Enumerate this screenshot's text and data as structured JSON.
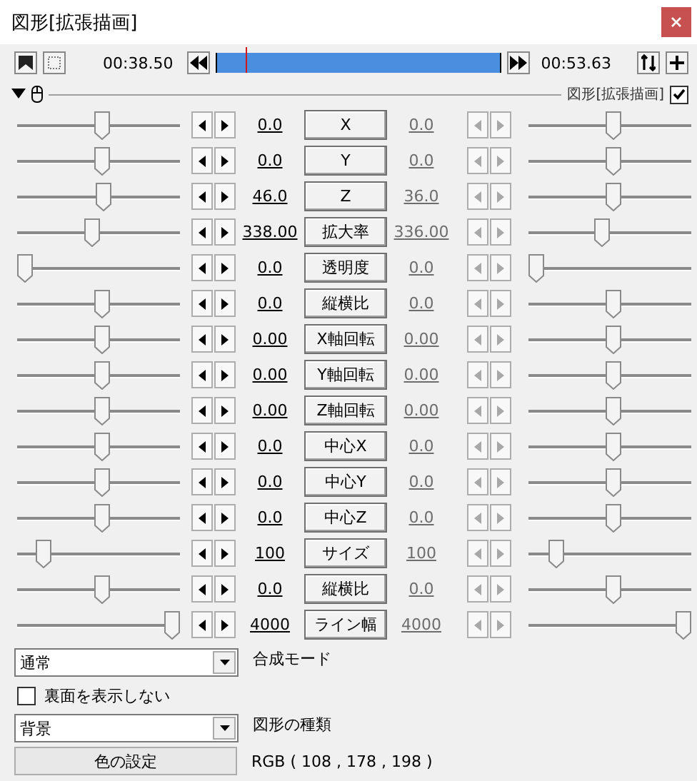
{
  "window": {
    "title": "図形[拡張描画]"
  },
  "toolbar": {
    "start_time": "00:38.50",
    "end_time": "00:53.63",
    "playhead": {
      "level": 0.1
    }
  },
  "object": {
    "label": "図形[拡張描画]",
    "checked": true,
    "expanded": true
  },
  "tracks": [
    {
      "name": "X",
      "start": {
        "value": "0.0",
        "level": 0.52
      },
      "end": {
        "value": "0.0",
        "level": 0.52,
        "disabled": true
      }
    },
    {
      "name": "Y",
      "start": {
        "value": "0.0",
        "level": 0.52
      },
      "end": {
        "value": "0.0",
        "level": 0.52,
        "disabled": true
      }
    },
    {
      "name": "Z",
      "start": {
        "value": "46.0",
        "level": 0.53
      },
      "end": {
        "value": "36.0",
        "level": 0.52,
        "disabled": true
      }
    },
    {
      "name": "拡大率",
      "start": {
        "value": "338.00",
        "level": 0.46
      },
      "end": {
        "value": "336.00",
        "level": 0.45,
        "disabled": true
      }
    },
    {
      "name": "透明度",
      "start": {
        "value": "0.0",
        "level": 0.0
      },
      "end": {
        "value": "0.0",
        "level": 0.0,
        "disabled": true
      }
    },
    {
      "name": "縦横比",
      "start": {
        "value": "0.0",
        "level": 0.52
      },
      "end": {
        "value": "0.0",
        "level": 0.52,
        "disabled": true
      }
    },
    {
      "name": "X軸回転",
      "start": {
        "value": "0.00",
        "level": 0.52
      },
      "end": {
        "value": "0.00",
        "level": 0.52,
        "disabled": true
      }
    },
    {
      "name": "Y軸回転",
      "start": {
        "value": "0.00",
        "level": 0.52
      },
      "end": {
        "value": "0.00",
        "level": 0.52,
        "disabled": true
      }
    },
    {
      "name": "Z軸回転",
      "start": {
        "value": "0.00",
        "level": 0.52
      },
      "end": {
        "value": "0.00",
        "level": 0.52,
        "disabled": true
      }
    },
    {
      "name": "中心X",
      "start": {
        "value": "0.0",
        "level": 0.52
      },
      "end": {
        "value": "0.0",
        "level": 0.52,
        "disabled": true
      }
    },
    {
      "name": "中心Y",
      "start": {
        "value": "0.0",
        "level": 0.52
      },
      "end": {
        "value": "0.0",
        "level": 0.52,
        "disabled": true
      }
    },
    {
      "name": "中心Z",
      "start": {
        "value": "0.0",
        "level": 0.52
      },
      "end": {
        "value": "0.0",
        "level": 0.52,
        "disabled": true
      }
    },
    {
      "name": "サイズ",
      "start": {
        "value": "100",
        "level": 0.13
      },
      "end": {
        "value": "100",
        "level": 0.14,
        "disabled": true
      }
    },
    {
      "name": "縦横比",
      "start": {
        "value": "0.0",
        "level": 0.52
      },
      "end": {
        "value": "0.0",
        "level": 0.52,
        "disabled": true
      }
    },
    {
      "name": "ライン幅",
      "start": {
        "value": "4000",
        "level": 1.0
      },
      "end": {
        "value": "4000",
        "level": 1.0,
        "disabled": true
      }
    }
  ],
  "blend_mode": {
    "value": "通常",
    "label": "合成モード"
  },
  "hide_backface": {
    "label": "裏面を表示しない",
    "checked": false
  },
  "shape_type": {
    "value": "背景",
    "label": "図形の種類"
  },
  "color": {
    "button": "色の設定",
    "value": "RGB ( 108 , 178 , 198 )"
  }
}
